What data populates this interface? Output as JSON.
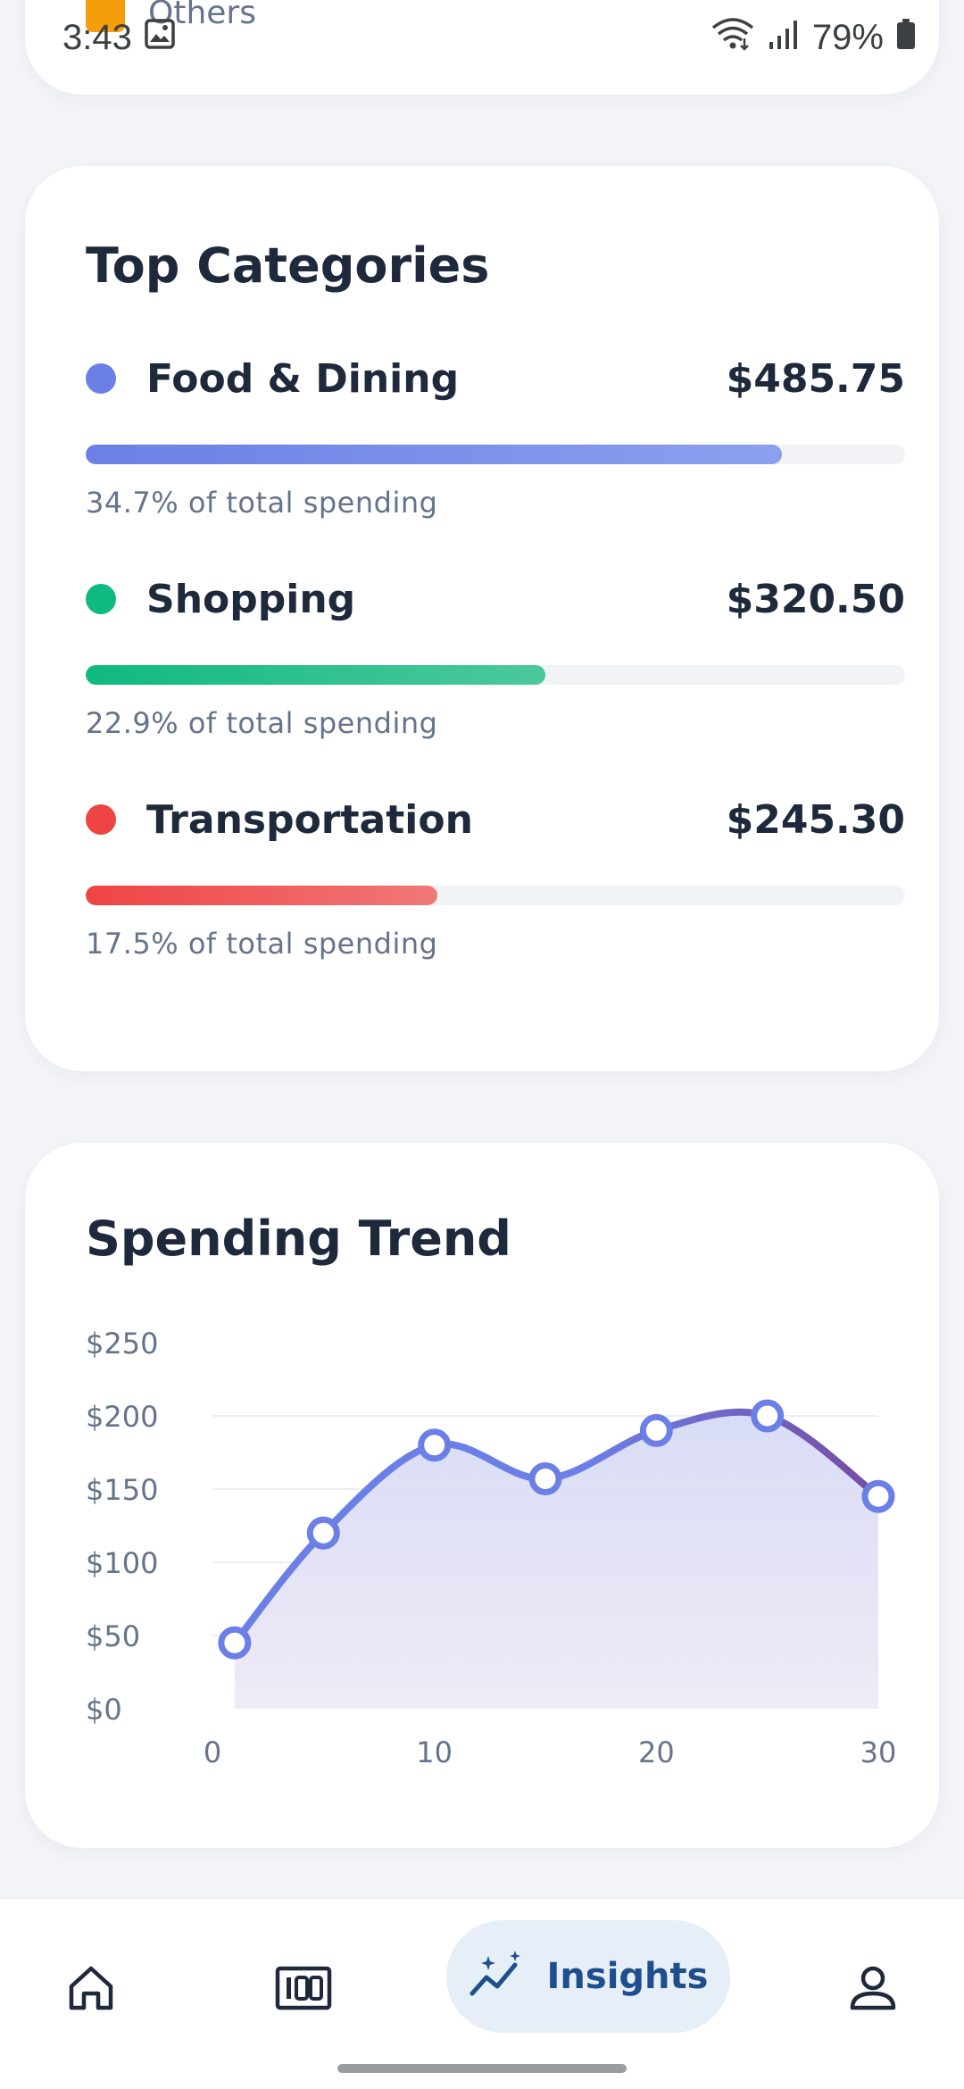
{
  "status_bar": {
    "time": "3:43",
    "battery": "79%",
    "icons": [
      "gallery-icon",
      "wifi-icon",
      "signal-icon",
      "battery-icon"
    ]
  },
  "previous_card": {
    "legend_label": "Others",
    "legend_color": "#f59e0b"
  },
  "top_categories": {
    "title": "Top Categories",
    "items": [
      {
        "name": "Food & Dining",
        "amount": "$485.75",
        "share_text": "34.7% of total spending",
        "share": 0.85,
        "color": "#6b7fe6",
        "color_end": "#8da0ee"
      },
      {
        "name": "Shopping",
        "amount": "$320.50",
        "share_text": "22.9% of total spending",
        "share": 0.561,
        "color": "#10b981",
        "color_end": "#4cc99c"
      },
      {
        "name": "Transportation",
        "amount": "$245.30",
        "share_text": "17.5% of total spending",
        "share": 0.429,
        "color": "#ef4444",
        "color_end": "#f17878"
      }
    ]
  },
  "spending_trend": {
    "title": "Spending Trend"
  },
  "chart_data": {
    "type": "area",
    "title": "Spending Trend",
    "x": [
      1,
      5,
      10,
      15,
      20,
      25,
      30
    ],
    "values": [
      45,
      120,
      180,
      157,
      190,
      200,
      145
    ],
    "xticks": [
      "0",
      "10",
      "20",
      "30"
    ],
    "xtick_values": [
      0,
      10,
      20,
      30
    ],
    "yticks": [
      "$0",
      "$50",
      "$100",
      "$150",
      "$200",
      "$250"
    ],
    "ytick_values": [
      0,
      50,
      100,
      150,
      200,
      250
    ],
    "xlim": [
      0,
      30
    ],
    "ylim": [
      0,
      250
    ],
    "grid": true,
    "line_color_start": "#6b7fe6",
    "line_color_end": "#764ba2",
    "fill_color": "#d6daf5"
  },
  "bottom_nav": {
    "items": [
      {
        "icon": "home-icon",
        "active": false
      },
      {
        "icon": "budget-icon",
        "active": false
      },
      {
        "icon": "insights-icon",
        "label": "Insights",
        "active": true
      },
      {
        "icon": "profile-icon",
        "active": false
      }
    ]
  }
}
